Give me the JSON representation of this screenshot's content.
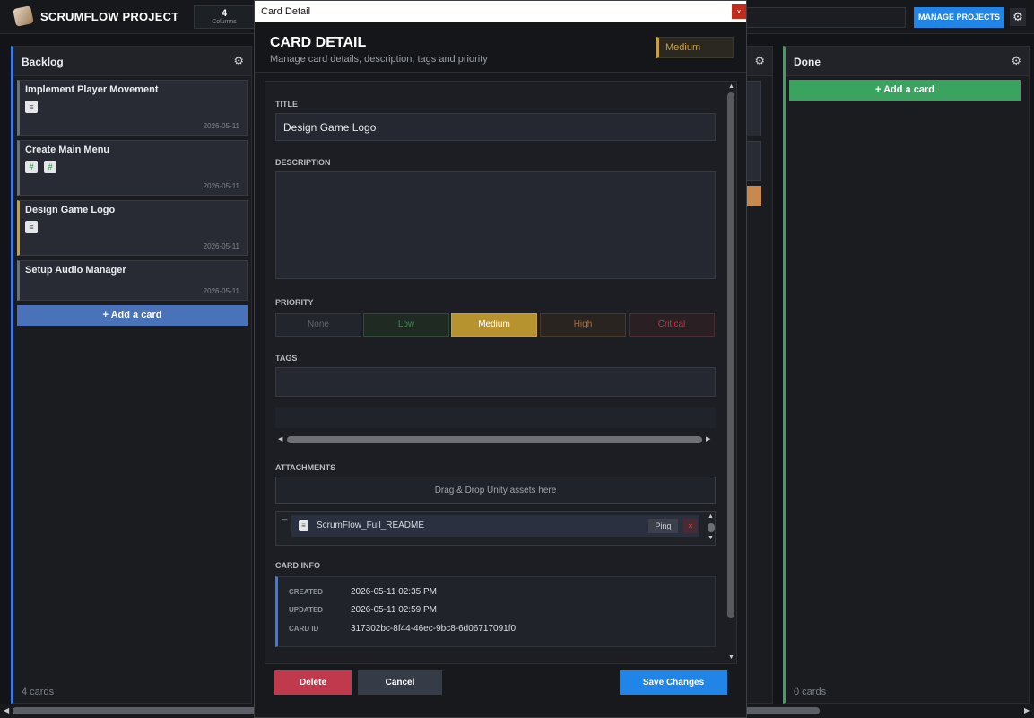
{
  "topbar": {
    "title": "SCRUMFLOW PROJECT",
    "stat_value": "4",
    "stat_label": "Columns",
    "manage_label": "MANAGE PROJECTS"
  },
  "columns": [
    {
      "title": "Backlog",
      "footer": "4 cards",
      "add_label": "+ Add a card",
      "accent": "#3c7be3",
      "cards": [
        {
          "title": "Implement Player Movement",
          "date": "2026-05-11"
        },
        {
          "title": "Create Main Menu",
          "date": "2026-05-11"
        },
        {
          "title": "Design Game Logo",
          "date": "2026-05-11"
        },
        {
          "title": "Setup Audio Manager",
          "date": "2026-05-11"
        }
      ]
    },
    {
      "title": "Done",
      "footer": "0 cards",
      "add_label": "+ Add a card",
      "accent": "#3aa35f",
      "cards": []
    }
  ],
  "modal": {
    "window_title": "Card Detail",
    "close_label": "×",
    "heading": "CARD DETAIL",
    "subtitle": "Manage card details, description, tags and priority",
    "priority_badge": "Medium",
    "title_label": "TITLE",
    "title_value": "Design Game Logo",
    "description_label": "DESCRIPTION",
    "description_value": "",
    "priority_label": "PRIORITY",
    "priorities": [
      "None",
      "Low",
      "Medium",
      "High",
      "Critical"
    ],
    "selected_priority": "Medium",
    "tags_label": "TAGS",
    "attachments_label": "ATTACHMENTS",
    "dropzone_text": "Drag & Drop Unity assets here",
    "attachment_name": "ScrumFlow_Full_README",
    "ping_label": "Ping",
    "remove_label": "×",
    "card_info_label": "CARD INFO",
    "info": {
      "created_key": "CREATED",
      "created_val": "2026-05-11 02:35 PM",
      "updated_key": "UPDATED",
      "updated_val": "2026-05-11 02:59 PM",
      "id_key": "CARD ID",
      "id_val": "317302bc-8f44-46ec-9bc8-6d06717091f0"
    },
    "delete_label": "Delete",
    "cancel_label": "Cancel",
    "save_label": "Save Changes"
  },
  "colors": {
    "accent_blue": "#2185e8",
    "medium_gold": "#c9a13b",
    "delete_red": "#c0394d",
    "done_green": "#3aa35f"
  }
}
